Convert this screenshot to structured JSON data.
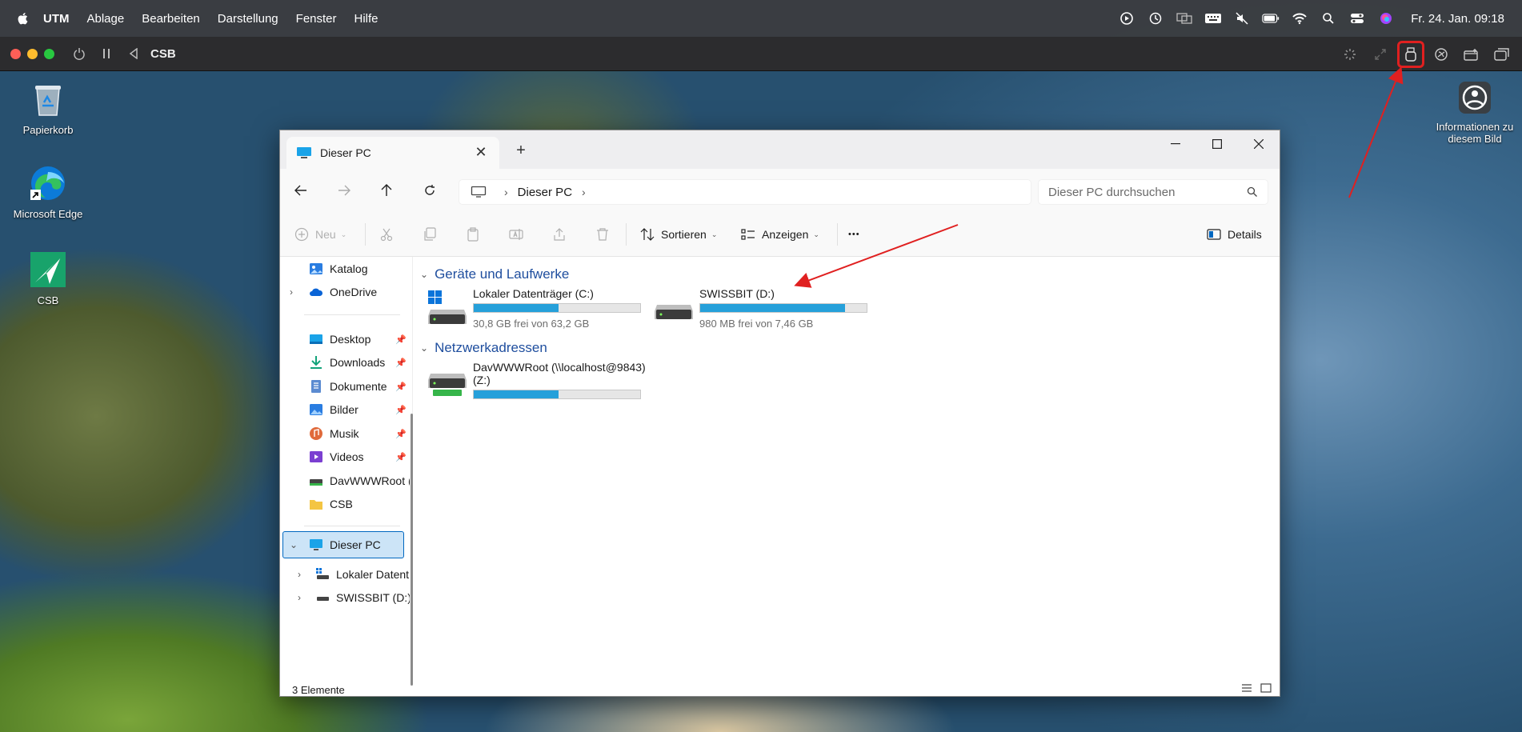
{
  "menubar": {
    "app": "UTM",
    "items": [
      "Ablage",
      "Bearbeiten",
      "Darstellung",
      "Fenster",
      "Hilfe"
    ],
    "clock": "Fr. 24. Jan.  09:18"
  },
  "utm": {
    "vm_title": "CSB"
  },
  "desktop": {
    "icons": [
      {
        "label": "Papierkorb"
      },
      {
        "label": "Microsoft Edge"
      },
      {
        "label": "CSB"
      }
    ],
    "info_icon_label": "Informationen zu diesem Bild"
  },
  "explorer": {
    "tab_title": "Dieser PC",
    "address": "Dieser PC",
    "search_placeholder": "Dieser PC durchsuchen",
    "cmd": {
      "new": "Neu",
      "sort": "Sortieren",
      "view": "Anzeigen",
      "more": "•••",
      "details": "Details"
    },
    "nav": {
      "katalog": "Katalog",
      "onedrive": "OneDrive",
      "desktop": "Desktop",
      "downloads": "Downloads",
      "dokumente": "Dokumente",
      "bilder": "Bilder",
      "musik": "Musik",
      "videos": "Videos",
      "davroot": "DavWWWRoot (",
      "csb": "CSB",
      "dieser_pc": "Dieser PC",
      "lokaler": "Lokaler Datent",
      "swissbit": "SWISSBIT (D:)"
    },
    "groups": {
      "drives": "Geräte und Laufwerke",
      "network": "Netzwerkadressen"
    },
    "drives": [
      {
        "name": "Lokaler Datenträger (C:)",
        "free": "30,8 GB frei von 63,2 GB",
        "used_fraction": 0.51
      },
      {
        "name": "SWISSBIT (D:)",
        "free": "980 MB frei von 7,46 GB",
        "used_fraction": 0.87
      }
    ],
    "network": [
      {
        "name_line1": "DavWWWRoot (\\\\localhost@9843)",
        "name_line2": "(Z:)",
        "used_fraction": 0.51
      }
    ],
    "status": "3 Elemente"
  },
  "colors": {
    "accent": "#0067c0",
    "drive_fill": "#26a0da",
    "annotation": "#e02020",
    "group_header": "#1f4e9e"
  }
}
